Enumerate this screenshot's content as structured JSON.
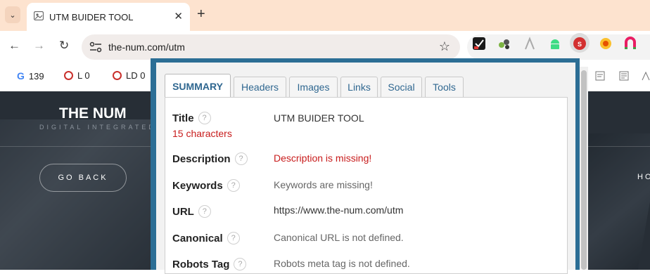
{
  "browser": {
    "tab": {
      "title": "UTM BUIDER TOOL",
      "close_glyph": "✕"
    },
    "new_tab_glyph": "+",
    "tab_search_glyph": "⌄",
    "nav": {
      "back_glyph": "←",
      "forward_glyph": "→",
      "reload_glyph": "↻"
    },
    "address": {
      "url": "the-num.com/utm",
      "star_glyph": "☆"
    },
    "bookmarks": [
      {
        "icon": "google-icon",
        "prefix": "G",
        "label": "139"
      },
      {
        "icon": "ring-icon",
        "label": "L  0"
      },
      {
        "icon": "ring-icon",
        "label": "LD  0"
      }
    ],
    "extensions": [
      "checklist-icon",
      "puzzle-icon",
      "pen-icon",
      "android-icon",
      "seo-icon",
      "badge-icon",
      "magnet-icon"
    ]
  },
  "website": {
    "brand": "THE NUM",
    "brand_sub": "DIGITAL INTEGRATED",
    "go_back": "GO BACK",
    "nav_partial": "HO"
  },
  "popup": {
    "tabs": [
      {
        "label": "SUMMARY",
        "active": true
      },
      {
        "label": "Headers",
        "active": false
      },
      {
        "label": "Images",
        "active": false
      },
      {
        "label": "Links",
        "active": false
      },
      {
        "label": "Social",
        "active": false
      },
      {
        "label": "Tools",
        "active": false
      }
    ],
    "help_glyph": "?",
    "rows": [
      {
        "label": "Title",
        "sub": "15 characters",
        "value": "UTM BUIDER TOOL",
        "value_color": "#333333"
      },
      {
        "label": "Description",
        "value": "Description is missing!",
        "value_color": "#c81c1c"
      },
      {
        "label": "Keywords",
        "value": "Keywords are missing!",
        "value_color": "#666666"
      },
      {
        "label": "URL",
        "value": "https://www.the-num.com/utm",
        "value_color": "#333333"
      },
      {
        "label": "Canonical",
        "value": "Canonical URL is not defined.",
        "value_color": "#666666"
      },
      {
        "label": "Robots Tag",
        "value": "Robots meta tag is not defined.",
        "value_color": "#666666"
      }
    ]
  },
  "colors": {
    "popup_border": "#2c6e95",
    "tab_text": "#2f6790",
    "error": "#c81c1c"
  }
}
